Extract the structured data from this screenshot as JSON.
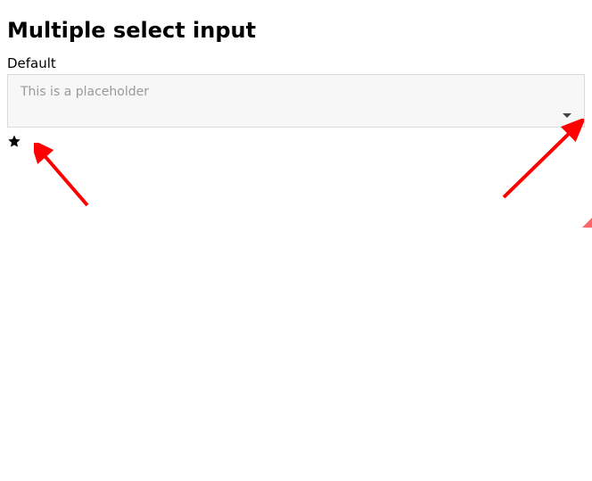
{
  "heading": "Multiple select input",
  "field": {
    "label": "Default",
    "placeholder": "This is a placeholder"
  }
}
